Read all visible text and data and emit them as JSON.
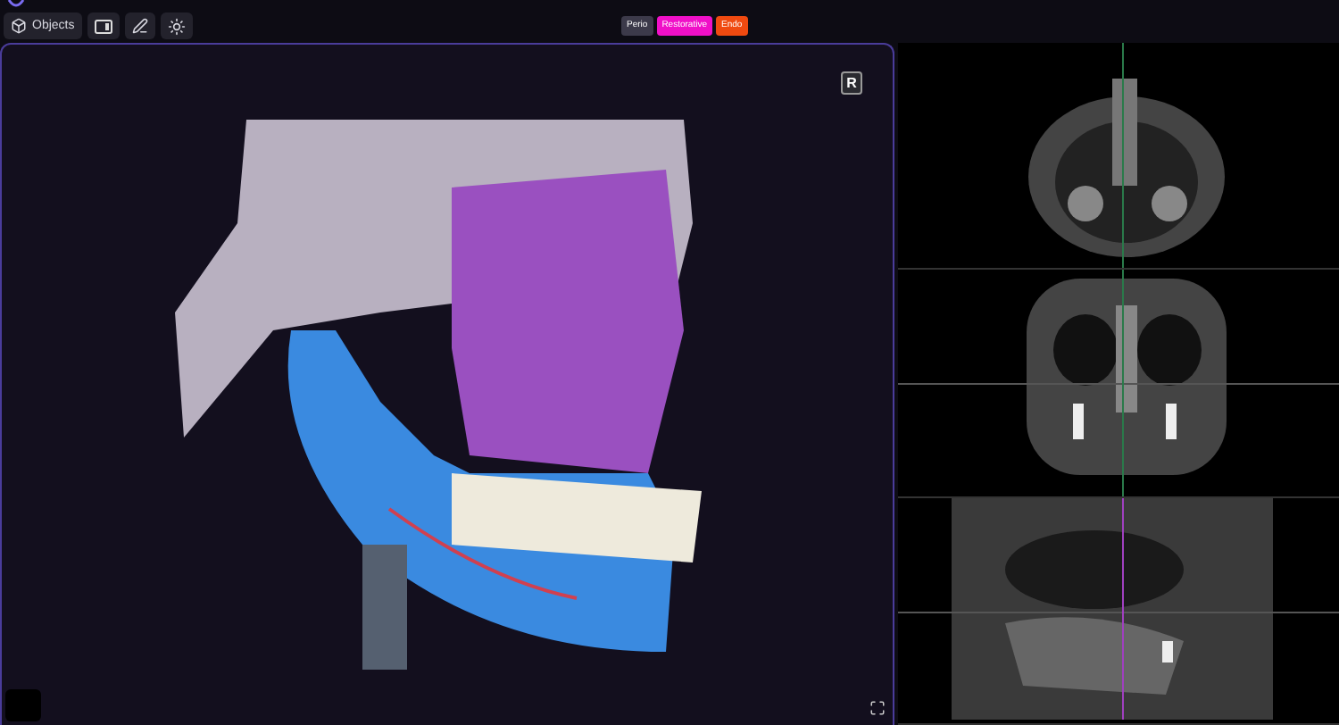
{
  "toolbar": {
    "objects_button": "Objects"
  },
  "filters": [
    {
      "label": "Perio",
      "color": "#3c3a4a"
    },
    {
      "label": "Restorative",
      "color": "#f010c8"
    },
    {
      "label": "Endo",
      "color": "#f04a10"
    }
  ],
  "viewer": {
    "orientation_badge": "R"
  },
  "slices": [
    {
      "kind": "axial"
    },
    {
      "kind": "coronal"
    },
    {
      "kind": "sagittal"
    }
  ]
}
